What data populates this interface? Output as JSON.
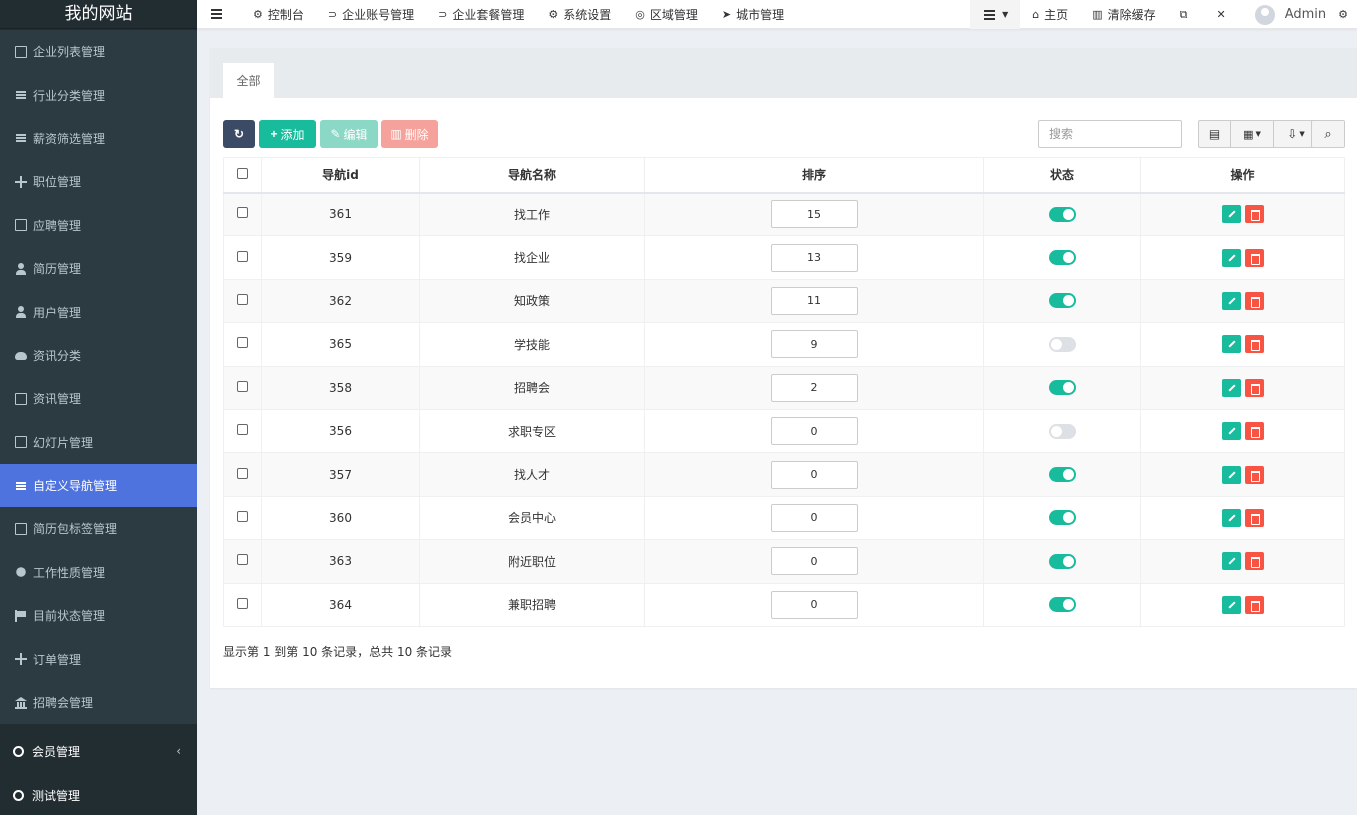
{
  "site_title": "我的网站",
  "sidebar": {
    "items": [
      {
        "label": "企业列表管理",
        "icon": "table-icon",
        "active": false
      },
      {
        "label": "行业分类管理",
        "icon": "bars-icon",
        "active": false
      },
      {
        "label": "薪资筛选管理",
        "icon": "list-icon",
        "active": false
      },
      {
        "label": "职位管理",
        "icon": "sitemap-icon",
        "active": false
      },
      {
        "label": "应聘管理",
        "icon": "map-icon",
        "active": false
      },
      {
        "label": "简历管理",
        "icon": "users-icon",
        "active": false
      },
      {
        "label": "用户管理",
        "icon": "user-icon",
        "active": false
      },
      {
        "label": "资讯分类",
        "icon": "cloud-icon",
        "active": false
      },
      {
        "label": "资讯管理",
        "icon": "newspaper-icon",
        "active": false
      },
      {
        "label": "幻灯片管理",
        "icon": "image-icon",
        "active": false
      },
      {
        "label": "自定义导航管理",
        "icon": "bars-icon",
        "active": true
      },
      {
        "label": "简历包标签管理",
        "icon": "id-card-icon",
        "active": false
      },
      {
        "label": "工作性质管理",
        "icon": "shield-icon",
        "active": false
      },
      {
        "label": "目前状态管理",
        "icon": "flag-icon",
        "active": false
      },
      {
        "label": "订单管理",
        "icon": "arrows-icon",
        "active": false
      },
      {
        "label": "招聘会管理",
        "icon": "bank-icon",
        "active": false
      }
    ],
    "groups": [
      {
        "label": "会员管理",
        "chevron": "‹"
      },
      {
        "label": "测试管理"
      }
    ]
  },
  "topnav": {
    "items": [
      {
        "label": "控制台",
        "icon": "⚙"
      },
      {
        "label": "企业账号管理",
        "icon": "⊃"
      },
      {
        "label": "企业套餐管理",
        "icon": "⊃"
      },
      {
        "label": "系统设置",
        "icon": "⚙"
      },
      {
        "label": "区域管理",
        "icon": "◎"
      },
      {
        "label": "城市管理",
        "icon": "➤"
      }
    ],
    "home": "主页",
    "clear_cache": "清除缓存",
    "user": "Admin"
  },
  "tabs": [
    {
      "label": "全部"
    }
  ],
  "toolbar": {
    "add": "添加",
    "edit": "编辑",
    "delete": "删除",
    "search_placeholder": "搜索"
  },
  "table": {
    "headers": [
      "导航id",
      "导航名称",
      "排序",
      "状态",
      "操作"
    ],
    "rows": [
      {
        "id": "361",
        "name": "找工作",
        "sort": "15",
        "status": true
      },
      {
        "id": "359",
        "name": "找企业",
        "sort": "13",
        "status": true
      },
      {
        "id": "362",
        "name": "知政策",
        "sort": "11",
        "status": true
      },
      {
        "id": "365",
        "name": "学技能",
        "sort": "9",
        "status": false
      },
      {
        "id": "358",
        "name": "招聘会",
        "sort": "2",
        "status": true
      },
      {
        "id": "356",
        "name": "求职专区",
        "sort": "0",
        "status": false
      },
      {
        "id": "357",
        "name": "找人才",
        "sort": "0",
        "status": true
      },
      {
        "id": "360",
        "name": "会员中心",
        "sort": "0",
        "status": true
      },
      {
        "id": "363",
        "name": "附近职位",
        "sort": "0",
        "status": true
      },
      {
        "id": "364",
        "name": "兼职招聘",
        "sort": "0",
        "status": true
      }
    ]
  },
  "pagination_info": "显示第 1 到第 10 条记录，总共 10 条记录",
  "colors": {
    "sidebar_bg": "#222d32",
    "active": "#4e73df",
    "primary": "#18bc9c",
    "danger": "#f75444"
  }
}
